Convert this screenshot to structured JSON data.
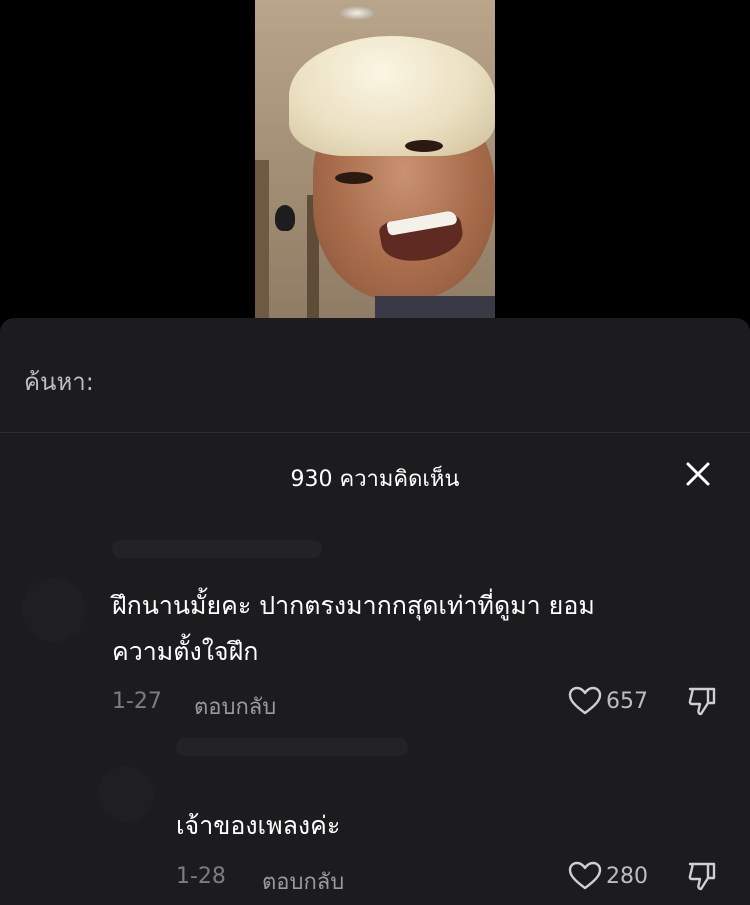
{
  "search": {
    "label": "ค้นหา:",
    "placeholder": ""
  },
  "comments_header": {
    "title": "930 ความคิดเห็น"
  },
  "comments": [
    {
      "text_line1": "ฝึกนานมั้ยคะ ปากตรงมากกสุดเท่าที่ดูมา ยอม",
      "text_line2": "ความตั้งใจฝึก",
      "date": "1-27",
      "reply_label": "ตอบกลับ",
      "likes": "657"
    },
    {
      "text_line1": "เจ้าของเพลงค่ะ",
      "date": "1-28",
      "reply_label": "ตอบกลับ",
      "likes": "280"
    }
  ],
  "icons": {
    "close": "close-icon",
    "like": "heart-icon",
    "dislike": "thumbs-down-icon"
  },
  "colors": {
    "sheet_bg": "#1c1c1e",
    "text_primary": "#ffffff",
    "text_muted": "#7d7d80"
  }
}
